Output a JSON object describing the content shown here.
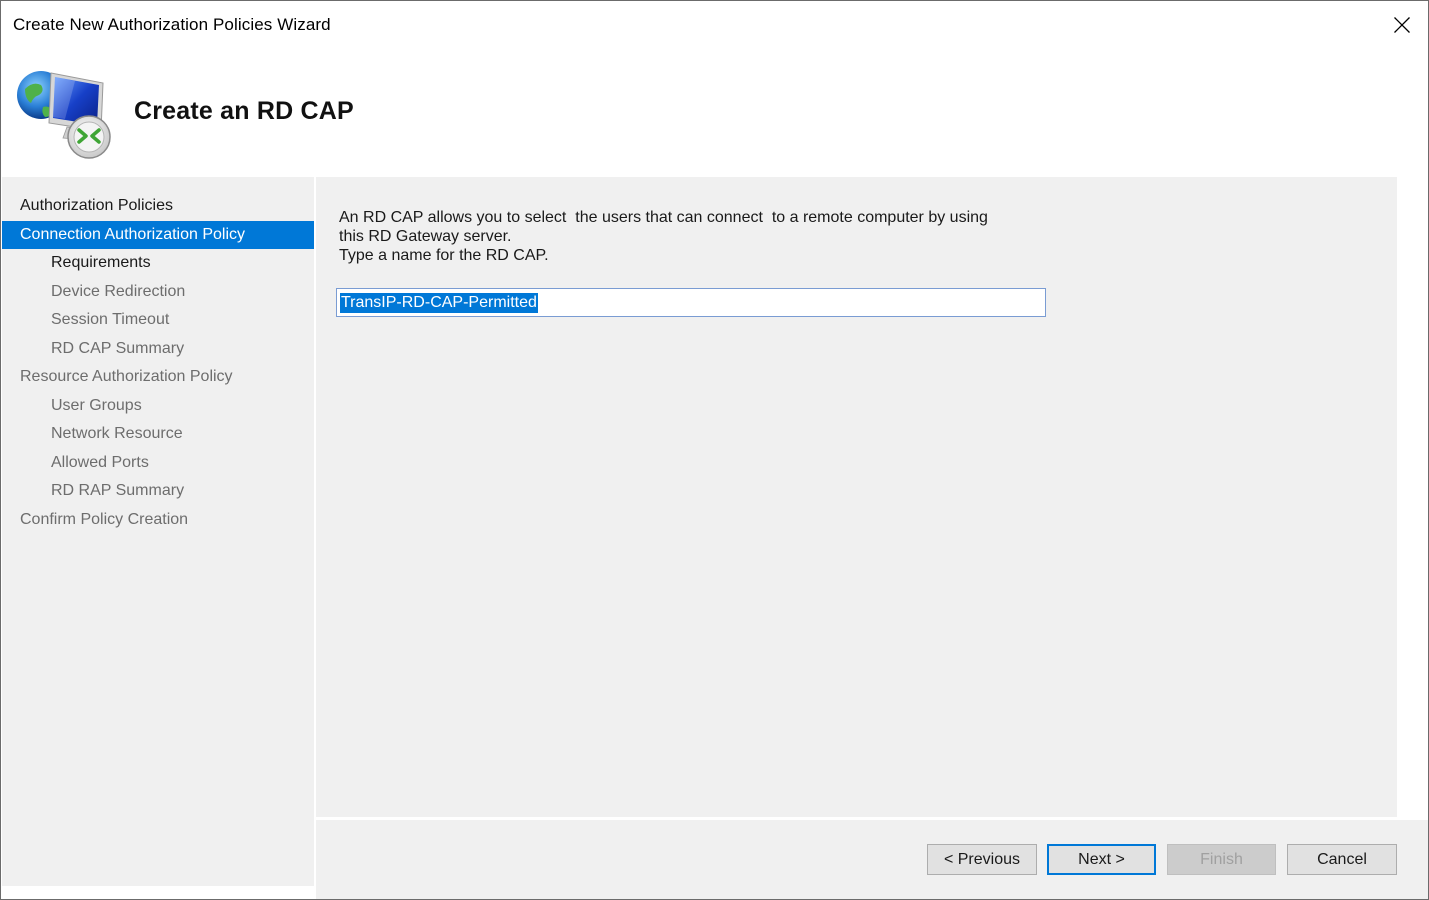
{
  "window": {
    "title": "Create New Authorization Policies Wizard",
    "close_icon": "close-icon"
  },
  "header": {
    "icon": "rd-gateway-globe-monitor-icon",
    "title": "Create an RD CAP"
  },
  "nav": {
    "items": [
      {
        "label": "Authorization Policies",
        "level": 0,
        "state": "header"
      },
      {
        "label": "Connection Authorization Policy",
        "level": 0,
        "state": "selected"
      },
      {
        "label": "Requirements",
        "level": 1,
        "state": "current"
      },
      {
        "label": "Device Redirection",
        "level": 1,
        "state": "pending"
      },
      {
        "label": "Session Timeout",
        "level": 1,
        "state": "pending"
      },
      {
        "label": "RD CAP Summary",
        "level": 1,
        "state": "pending"
      },
      {
        "label": "Resource Authorization Policy",
        "level": 0,
        "state": "pending"
      },
      {
        "label": "User Groups",
        "level": 1,
        "state": "pending"
      },
      {
        "label": "Network Resource",
        "level": 1,
        "state": "pending"
      },
      {
        "label": "Allowed Ports",
        "level": 1,
        "state": "pending"
      },
      {
        "label": "RD RAP Summary",
        "level": 1,
        "state": "pending"
      },
      {
        "label": "Confirm Policy Creation",
        "level": 0,
        "state": "pending"
      }
    ]
  },
  "content": {
    "description_lines": [
      "An RD CAP allows you to select  the users that can connect  to a remote computer by using",
      "this RD Gateway server.",
      "Type a name for the RD CAP."
    ],
    "name_field": {
      "value": "TransIP-RD-CAP-Permitted",
      "selected": true
    }
  },
  "buttons": {
    "previous": "< Previous",
    "next": "Next >",
    "finish": "Finish",
    "cancel": "Cancel"
  },
  "colors": {
    "accent": "#0078d7",
    "panel_bg": "#f0f0f0",
    "disabled_text": "#a0a0a0"
  }
}
